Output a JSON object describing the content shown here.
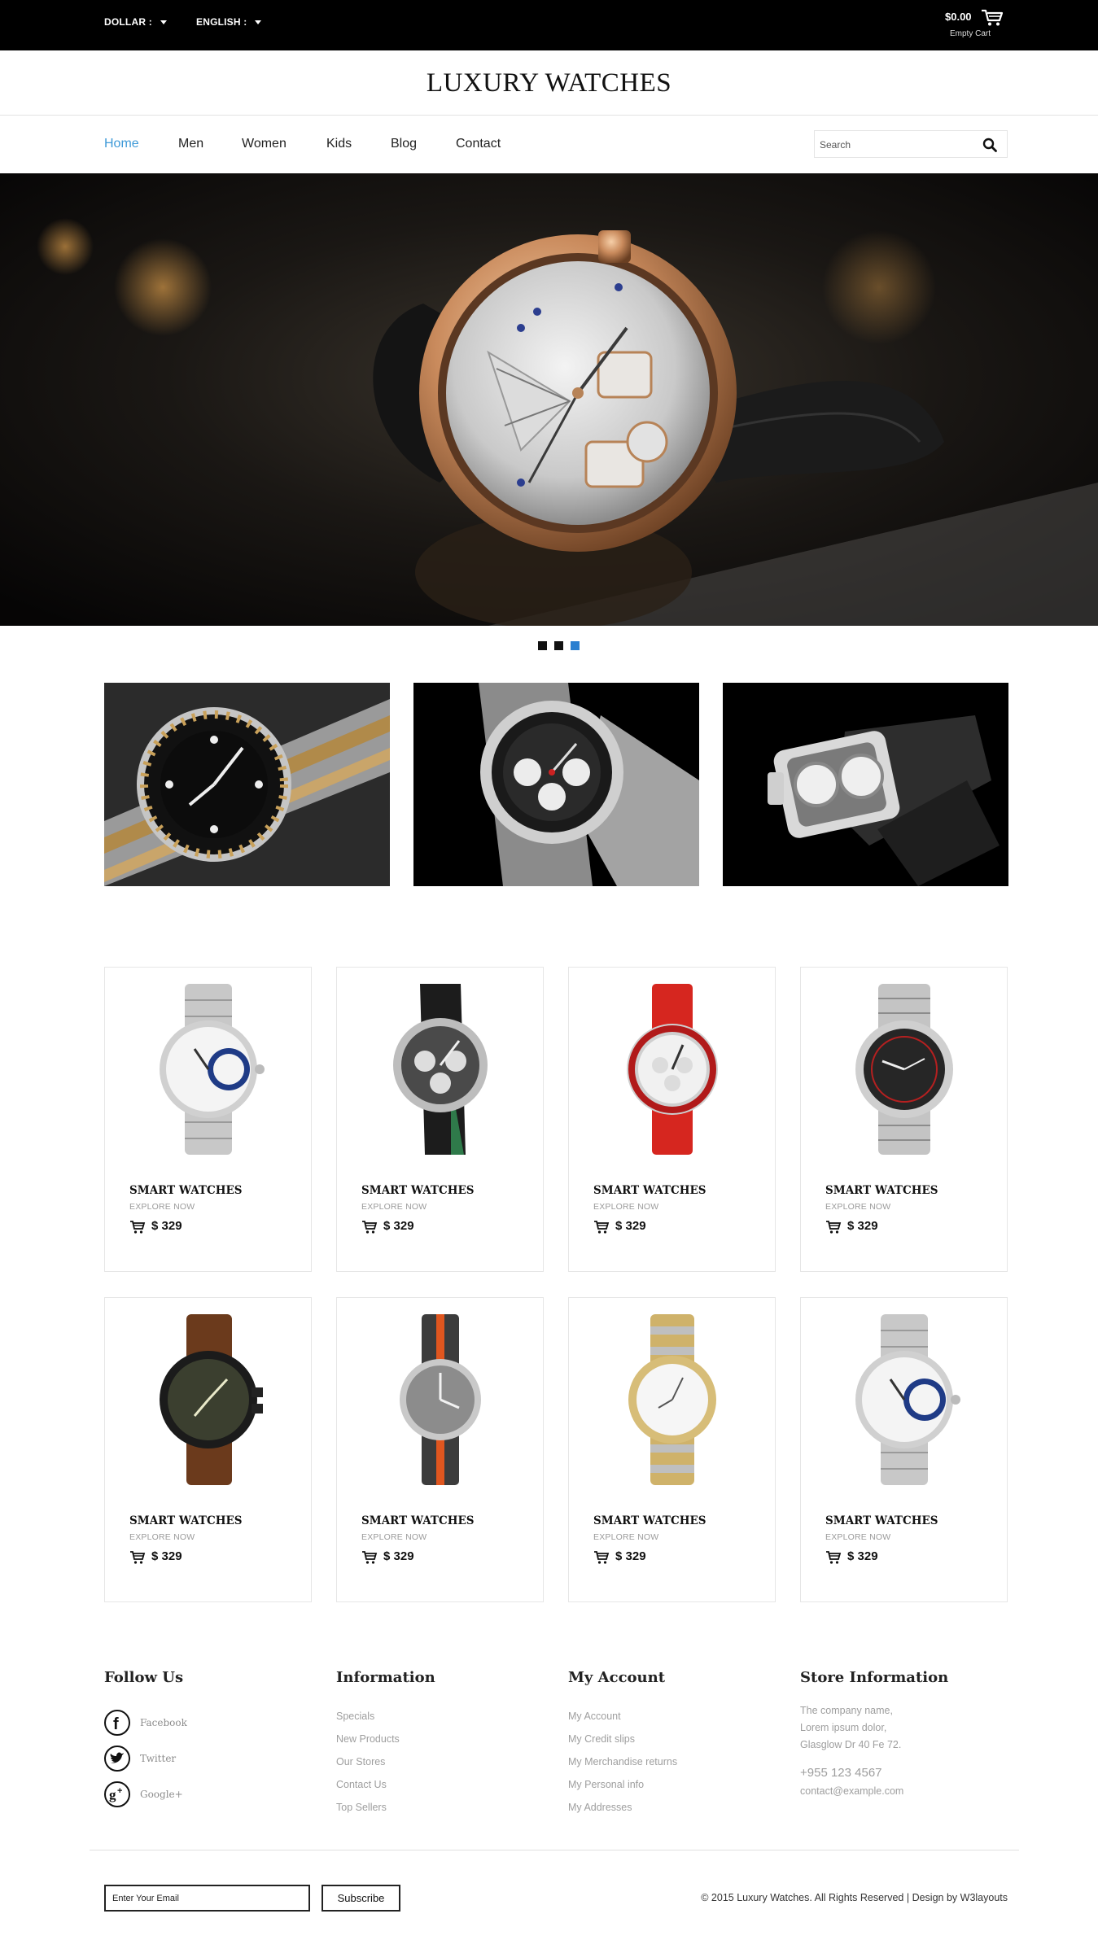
{
  "topbar": {
    "currency_label": "DOLLAR :",
    "language_label": "ENGLISH :",
    "cart_amount": "$0.00",
    "cart_status": "Empty Cart",
    "cart_icon": "shopping-cart-icon"
  },
  "logo": {
    "text": "LUXURY WATCHES"
  },
  "nav": {
    "items": [
      {
        "label": "Home",
        "active": true
      },
      {
        "label": "Men"
      },
      {
        "label": "Women"
      },
      {
        "label": "Kids"
      },
      {
        "label": "Blog"
      },
      {
        "label": "Contact"
      }
    ],
    "search_placeholder": "Search",
    "search_icon": "search-icon",
    "active_color": "#3f9ad8"
  },
  "slider": {
    "active_dot": 3,
    "dot_count": 3,
    "active_dot_color": "#2a7fd0"
  },
  "products": [
    {
      "title": "SMART WATCHES",
      "explore": "EXPLORE NOW",
      "price": "$ 329"
    },
    {
      "title": "SMART WATCHES",
      "explore": "EXPLORE NOW",
      "price": "$ 329"
    },
    {
      "title": "SMART WATCHES",
      "explore": "EXPLORE NOW",
      "price": "$ 329"
    },
    {
      "title": "SMART WATCHES",
      "explore": "EXPLORE NOW",
      "price": "$ 329"
    },
    {
      "title": "SMART WATCHES",
      "explore": "EXPLORE NOW",
      "price": "$ 329"
    },
    {
      "title": "SMART WATCHES",
      "explore": "EXPLORE NOW",
      "price": "$ 329"
    },
    {
      "title": "SMART WATCHES",
      "explore": "EXPLORE NOW",
      "price": "$ 329"
    },
    {
      "title": "SMART WATCHES",
      "explore": "EXPLORE NOW",
      "price": "$ 329"
    }
  ],
  "footer": {
    "follow": {
      "title": "Follow Us",
      "links": [
        {
          "label": "Facebook",
          "icon": "facebook-icon"
        },
        {
          "label": "Twitter",
          "icon": "twitter-icon"
        },
        {
          "label": "Google+",
          "icon": "google-plus-icon"
        }
      ]
    },
    "information": {
      "title": "Information",
      "links": [
        "Specials",
        "New Products",
        "Our Stores",
        "Contact Us",
        "Top Sellers"
      ]
    },
    "account": {
      "title": "My Account",
      "links": [
        "My Account",
        "My Credit slips",
        "My Merchandise returns",
        "My Personal info",
        "My Addresses"
      ]
    },
    "store": {
      "title": "Store Information",
      "address_lines": [
        "The company name,",
        "Lorem ipsum dolor,",
        "Glasglow Dr 40 Fe 72."
      ],
      "phone": "+955 123 4567",
      "email": "contact@example.com"
    },
    "newsletter": {
      "placeholder": "Enter Your Email",
      "button": "Subscribe"
    },
    "copyright": "© 2015 Luxury Watches. All Rights Reserved | Design by",
    "designer": "W3layouts"
  }
}
